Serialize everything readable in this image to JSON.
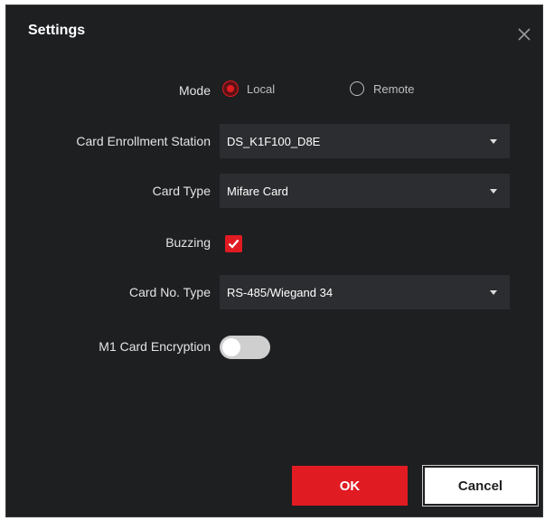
{
  "dialog": {
    "title": "Settings",
    "close_icon": "close-icon"
  },
  "mode": {
    "label": "Mode",
    "options": [
      {
        "label": "Local",
        "selected": true
      },
      {
        "label": "Remote",
        "selected": false
      }
    ]
  },
  "card_enrollment_station": {
    "label": "Card Enrollment Station",
    "value": "DS_K1F100_D8E"
  },
  "card_type": {
    "label": "Card Type",
    "value": "Mifare Card"
  },
  "buzzing": {
    "label": "Buzzing",
    "checked": true
  },
  "card_no_type": {
    "label": "Card No. Type",
    "value": "RS-485/Wiegand 34"
  },
  "m1_card_encryption": {
    "label": "M1 Card Encryption",
    "enabled": false
  },
  "buttons": {
    "ok": "OK",
    "cancel": "Cancel"
  },
  "colors": {
    "accent": "#e11b22",
    "background": "#1e1f21",
    "field": "#2c2d30"
  }
}
